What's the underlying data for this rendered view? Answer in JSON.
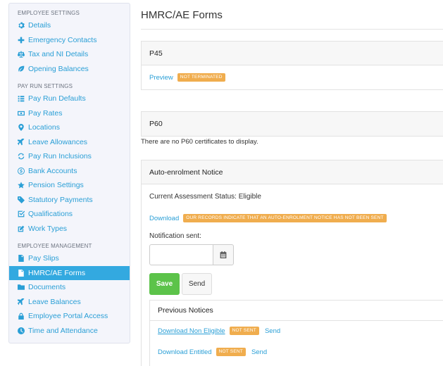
{
  "sidebar": {
    "sections": [
      {
        "title": "EMPLOYEE SETTINGS",
        "items": [
          {
            "label": "Details",
            "icon": "gear-icon"
          },
          {
            "label": "Emergency Contacts",
            "icon": "plus-icon"
          },
          {
            "label": "Tax and NI Details",
            "icon": "scales-icon"
          },
          {
            "label": "Opening Balances",
            "icon": "leaf-icon"
          }
        ]
      },
      {
        "title": "PAY RUN SETTINGS",
        "items": [
          {
            "label": "Pay Run Defaults",
            "icon": "list-icon"
          },
          {
            "label": "Pay Rates",
            "icon": "money-icon"
          },
          {
            "label": "Locations",
            "icon": "map-marker-icon"
          },
          {
            "label": "Leave Allowances",
            "icon": "plane-icon"
          },
          {
            "label": "Pay Run Inclusions",
            "icon": "refresh-icon"
          },
          {
            "label": "Bank Accounts",
            "icon": "dollar-circle-icon"
          },
          {
            "label": "Pension Settings",
            "icon": "star-icon"
          },
          {
            "label": "Statutory Payments",
            "icon": "tag-icon"
          },
          {
            "label": "Qualifications",
            "icon": "check-square-icon"
          },
          {
            "label": "Work Types",
            "icon": "edit-icon"
          }
        ]
      },
      {
        "title": "EMPLOYEE MANAGEMENT",
        "items": [
          {
            "label": "Pay Slips",
            "icon": "file-icon"
          },
          {
            "label": "HMRC/AE Forms",
            "icon": "file-icon",
            "active": true
          },
          {
            "label": "Documents",
            "icon": "folder-icon"
          },
          {
            "label": "Leave Balances",
            "icon": "plane-icon"
          },
          {
            "label": "Employee Portal Access",
            "icon": "lock-icon"
          },
          {
            "label": "Time and Attendance",
            "icon": "clock-icon"
          }
        ]
      }
    ]
  },
  "main": {
    "title": "HMRC/AE Forms",
    "p45": {
      "title": "P45",
      "preview_label": "Preview",
      "badge": "NOT TERMINATED"
    },
    "p60": {
      "title": "P60",
      "empty_text": "There are no P60 certificates to display."
    },
    "ae": {
      "title": "Auto-enrolment Notice",
      "status": "Current Assessment Status: Eligible",
      "download_label": "Download",
      "download_badge": "OUR RECORDS INDICATE THAT AN AUTO-ENROLMENT NOTICE HAS NOT BEEN SENT",
      "notification_label": "Notification sent:",
      "date_value": "",
      "save_label": "Save",
      "send_label": "Send",
      "previous": {
        "title": "Previous Notices",
        "rows": [
          {
            "label": "Download Non Eligible",
            "badge": "NOT SENT",
            "send": "Send"
          },
          {
            "label": "Download Entitled",
            "badge": "NOT SENT",
            "send": "Send"
          }
        ]
      }
    }
  },
  "colors": {
    "accent": "#2a9fd6",
    "active_bg": "#33a9e0",
    "badge": "#f0ad4e",
    "save": "#5cc34a"
  }
}
